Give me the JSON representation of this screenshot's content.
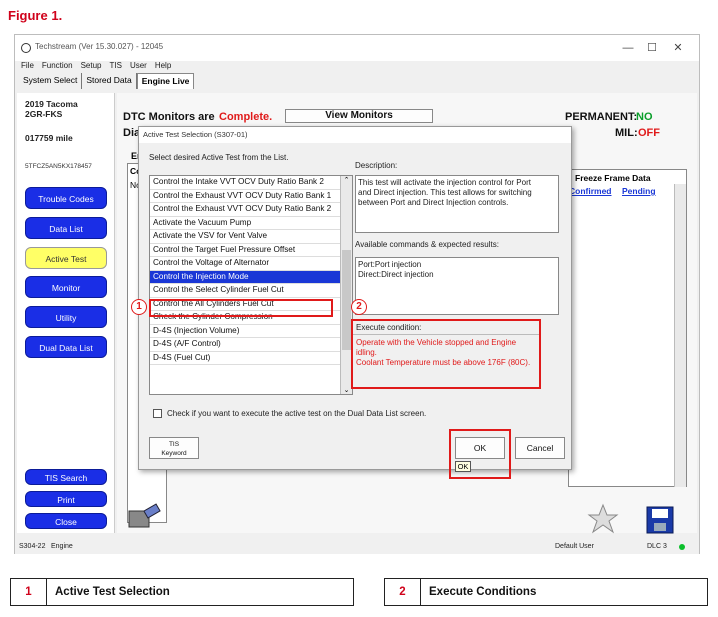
{
  "figure_title": "Figure 1.",
  "app": {
    "title": "Techstream (Ver 15.30.027) - 12045",
    "menu": [
      "File",
      "Function",
      "Setup",
      "TIS",
      "User",
      "Help"
    ],
    "tabs": [
      "System Select",
      "Stored Data",
      "Engine Live"
    ]
  },
  "vehicle": {
    "model": "2019 Tacoma",
    "engine": "2GR-FKS",
    "mileage": "017759 mile",
    "vin": "5TFCZ5AN5KX178457"
  },
  "sidebar": {
    "buttons": [
      "Trouble Codes",
      "Data List",
      "Active Test",
      "Monitor",
      "Utility",
      "Dual Data List"
    ],
    "bottom_buttons": [
      "TIS Search",
      "Print",
      "Close"
    ]
  },
  "main": {
    "dtc_label": "DTC Monitors are",
    "dtc_status": "Complete.",
    "view_monitors": "View Monitors",
    "permanent_label": "PERMANENT:",
    "permanent_value": "NO",
    "mil_label": "MIL:",
    "mil_value": "OFF",
    "partial_dia": "Dia",
    "partial_er": "Er",
    "partial_co": "Co",
    "partial_no": "No",
    "freeze_frame": "Freeze Frame Data",
    "confirmed": "Confirmed",
    "pending": "Pending"
  },
  "dialog": {
    "title": "Active Test Selection (S307-01)",
    "instruction": "Select desired Active Test from the List.",
    "list_items": [
      "Control the Intake VVT OCV Duty Ratio Bank 2",
      "Control the Exhaust VVT OCV Duty Ratio Bank 1",
      "Control the Exhaust VVT OCV Duty Ratio Bank 2",
      "Activate the Vacuum Pump",
      "Activate the VSV for Vent Valve",
      "Control the Target Fuel Pressure Offset",
      "Control the Voltage of Alternator",
      "Control the Injection Mode",
      "Control the Select Cylinder Fuel Cut",
      "Control the All Cylinders Fuel Cut",
      "Check the Cylinder Compression",
      "D-4S (Injection Volume)",
      "D-4S (A/F Control)",
      "D-4S (Fuel Cut)"
    ],
    "selected_index": 7,
    "description_label": "Description:",
    "description_text": "This test will activate the injection control for Port and Direct injection. This test allows for switching between Port and Direct Injection controls.",
    "commands_label": "Available commands & expected results:",
    "commands_text": [
      "Port:Port injection",
      "Direct:Direct injection"
    ],
    "execute_label": "Execute condition:",
    "execute_text": [
      "Operate with the Vehicle stopped and Engine idling.",
      "Coolant Temperature must be above 176F (80C)."
    ],
    "checkbox_label": "Check if you want to execute the active test on the Dual Data List screen.",
    "tis_keyword": [
      "TIS",
      "Keyword"
    ],
    "ok": "OK",
    "cancel": "Cancel",
    "ok_tooltip": "OK"
  },
  "statusbar": {
    "left": "S304-22",
    "engine": "Engine",
    "user": "Default User",
    "dlc": "DLC 3"
  },
  "markers": [
    "1",
    "2"
  ],
  "legend": [
    {
      "num": "1",
      "label": "Active Test Selection"
    },
    {
      "num": "2",
      "label": "Execute Conditions"
    }
  ],
  "colors": {
    "accent_red": "#e01a1a",
    "sidebar_blue": "#1a2ee6",
    "selected_yellow": "#ffff66",
    "selection_blue": "#1a37d6"
  }
}
